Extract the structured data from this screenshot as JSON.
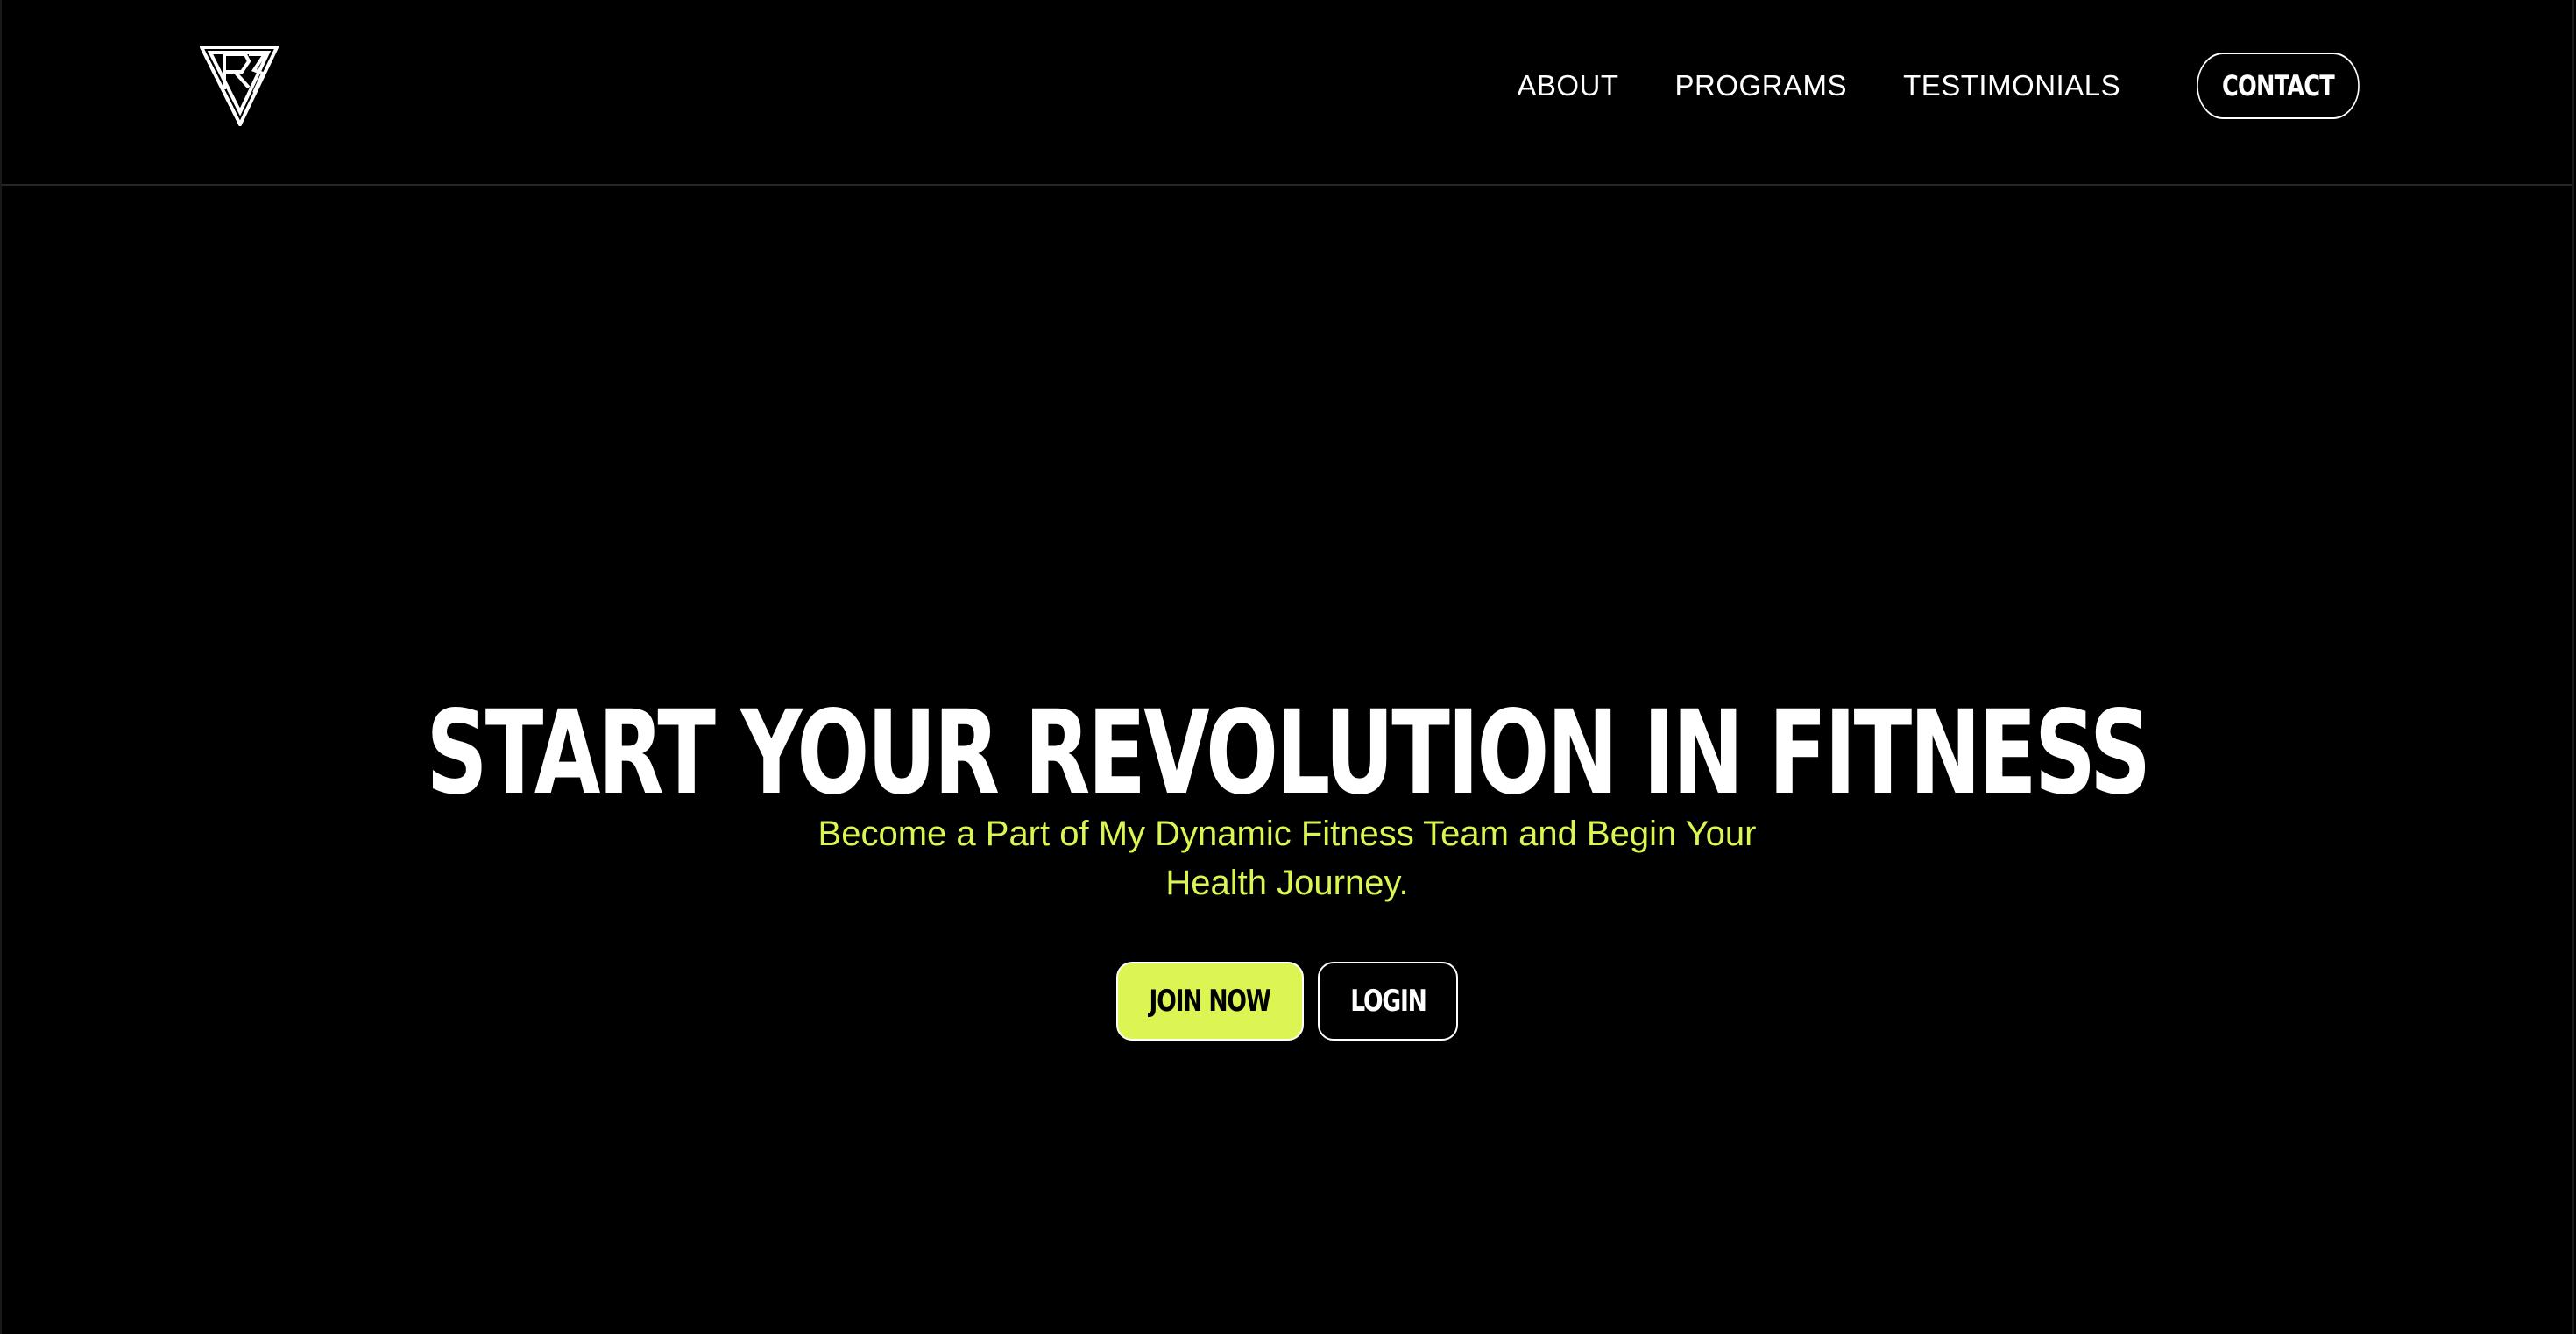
{
  "colors": {
    "background": "#000000",
    "accent": "#dcf553",
    "text": "#ffffff"
  },
  "header": {
    "logo_icon": "triangle-monogram-logo-icon",
    "nav": {
      "about": "ABOUT",
      "programs": "PROGRAMS",
      "testimonials": "TESTIMONIALS",
      "contact": "CONTACT"
    }
  },
  "hero": {
    "title": "START YOUR REVOLUTION IN FITNESS",
    "subtitle": "Become a Part of My Dynamic Fitness Team and Begin Your Health Journey.",
    "join_label": "JOIN NOW",
    "login_label": "LOGIN"
  }
}
